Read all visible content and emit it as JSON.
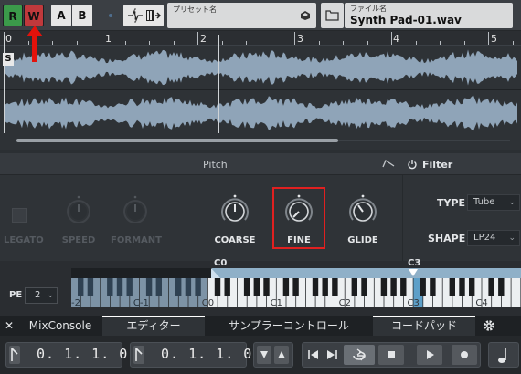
{
  "toolbar": {
    "record_label": "R",
    "write_label": "W",
    "compare_a_label": "A",
    "compare_b_label": "B",
    "preset_label": "プリセット名",
    "preset_value": "",
    "file_label": "ファイル名",
    "file_name": "Synth Pad-01.wav"
  },
  "ruler": {
    "markers": [
      "0",
      "1",
      "2",
      "3",
      "4",
      "5"
    ]
  },
  "waveform": {
    "start_marker": "S"
  },
  "pitch": {
    "title": "Pitch",
    "legato_label": "LEGATO",
    "speed_label": "SPEED",
    "formant_label": "FORMANT",
    "coarse_label": "COARSE",
    "fine_label": "FINE",
    "glide_label": "GLIDE"
  },
  "filter": {
    "title": "Filter",
    "type_label": "TYPE",
    "type_value": "Tube",
    "shape_label": "SHAPE",
    "shape_value": "LP24"
  },
  "keyboard": {
    "pe_label": "PE",
    "pe_value": "2",
    "range_low": "C0",
    "range_root": "C3",
    "octave_labels": [
      "C-2",
      "C-1",
      "C0",
      "C1",
      "C2",
      "C3",
      "C4"
    ]
  },
  "tabs": {
    "close": "✕",
    "mixconsole": "MixConsole",
    "editor": "エディター",
    "sampler_control": "サンプラーコントロール",
    "chord_pads": "コードパッド"
  },
  "transport": {
    "left_locator": "0. 1. 1.   0",
    "right_locator": "0. 1. 1.   0"
  },
  "colors": {
    "record": "#3b9a4a",
    "write": "#c0393c",
    "highlight": "#e02020",
    "waveform": "#8fa4b8"
  }
}
